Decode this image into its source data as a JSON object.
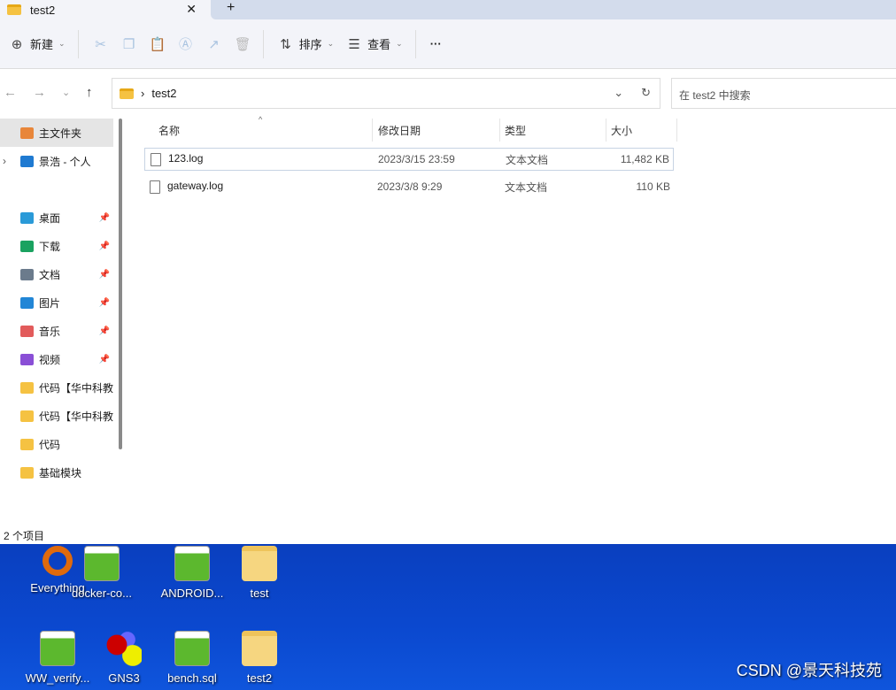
{
  "tab": {
    "title": "test2",
    "close": "✕",
    "new_tab": "+"
  },
  "toolbar": {
    "new_label": "新建",
    "sort_label": "排序",
    "view_label": "查看",
    "more": "···"
  },
  "address": {
    "path": "test2",
    "search_placeholder": "在 test2 中搜索"
  },
  "sidebar": {
    "items": [
      {
        "label": "主文件夹",
        "color": "#e8863a"
      },
      {
        "label": "景浩 - 个人",
        "color": "#1f7ad1"
      },
      {
        "label": "桌面",
        "color": "#2a9ad8",
        "pinned": true
      },
      {
        "label": "下载",
        "color": "#1aa260",
        "pinned": true
      },
      {
        "label": "文档",
        "color": "#6b7b8c",
        "pinned": true
      },
      {
        "label": "图片",
        "color": "#2286d6",
        "pinned": true
      },
      {
        "label": "音乐",
        "color": "#e25b5b",
        "pinned": true
      },
      {
        "label": "视频",
        "color": "#8a4fd6",
        "pinned": true
      },
      {
        "label": "代码【华中科教",
        "color": "#f5c242"
      },
      {
        "label": "代码【华中科教",
        "color": "#f5c242"
      },
      {
        "label": "代码",
        "color": "#f5c242"
      },
      {
        "label": "基础模块",
        "color": "#f5c242"
      }
    ]
  },
  "columns": {
    "name": "名称",
    "date": "修改日期",
    "type": "类型",
    "size": "大小"
  },
  "files": [
    {
      "name": "123.log",
      "date": "2023/3/15 23:59",
      "type": "文本文档",
      "size": "11,482 KB"
    },
    {
      "name": "gateway.log",
      "date": "2023/3/8 9:29",
      "type": "文本文档",
      "size": "110 KB"
    }
  ],
  "status": "2 个项目",
  "desktop": {
    "icons": [
      "Everything",
      "docker-co...",
      "ANDROID...",
      "test",
      "WW_verify...",
      "GNS3",
      "bench.sql",
      "test2"
    ],
    "watermark": "CSDN @景天科技苑"
  }
}
